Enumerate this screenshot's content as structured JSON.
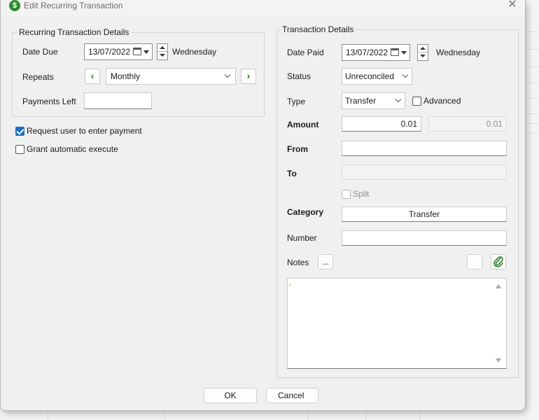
{
  "window": {
    "title": "Edit Recurring Transaction",
    "app_icon_glyph": "$",
    "close_glyph": "✕"
  },
  "recurring": {
    "group_title": "Recurring Transaction Details",
    "date_due_label": "Date Due",
    "date_due_value": "13/07/2022",
    "date_due_weekday": "Wednesday",
    "repeats_label": "Repeats",
    "repeats_value": "Monthly",
    "prev_glyph": "‹",
    "next_glyph": "›",
    "payments_left_label": "Payments Left",
    "payments_left_value": ""
  },
  "options": {
    "request_payment_label": "Request user to enter payment",
    "request_payment_checked": true,
    "grant_execute_label": "Grant automatic execute",
    "grant_execute_checked": false
  },
  "transaction": {
    "group_title": "Transaction Details",
    "date_paid_label": "Date Paid",
    "date_paid_value": "13/07/2022",
    "date_paid_weekday": "Wednesday",
    "status_label": "Status",
    "status_value": "Unreconciled",
    "type_label": "Type",
    "type_value": "Transfer",
    "advanced_label": "Advanced",
    "amount_label": "Amount",
    "amount_value": "0.01",
    "amount_secondary_value": "0.01",
    "from_label": "From",
    "from_value": "",
    "to_label": "To",
    "to_value": "",
    "split_label": "Split",
    "category_label": "Category",
    "category_value": "Transfer",
    "number_label": "Number",
    "number_value": "",
    "notes_label": "Notes",
    "notes_button_label": "...",
    "notes_text": ","
  },
  "buttons": {
    "ok": "OK",
    "cancel": "Cancel"
  },
  "colors": {
    "accent_blue": "#1d6fc4",
    "nav_green": "#1f7a1f",
    "app_icon_green": "#2e8b2e"
  }
}
